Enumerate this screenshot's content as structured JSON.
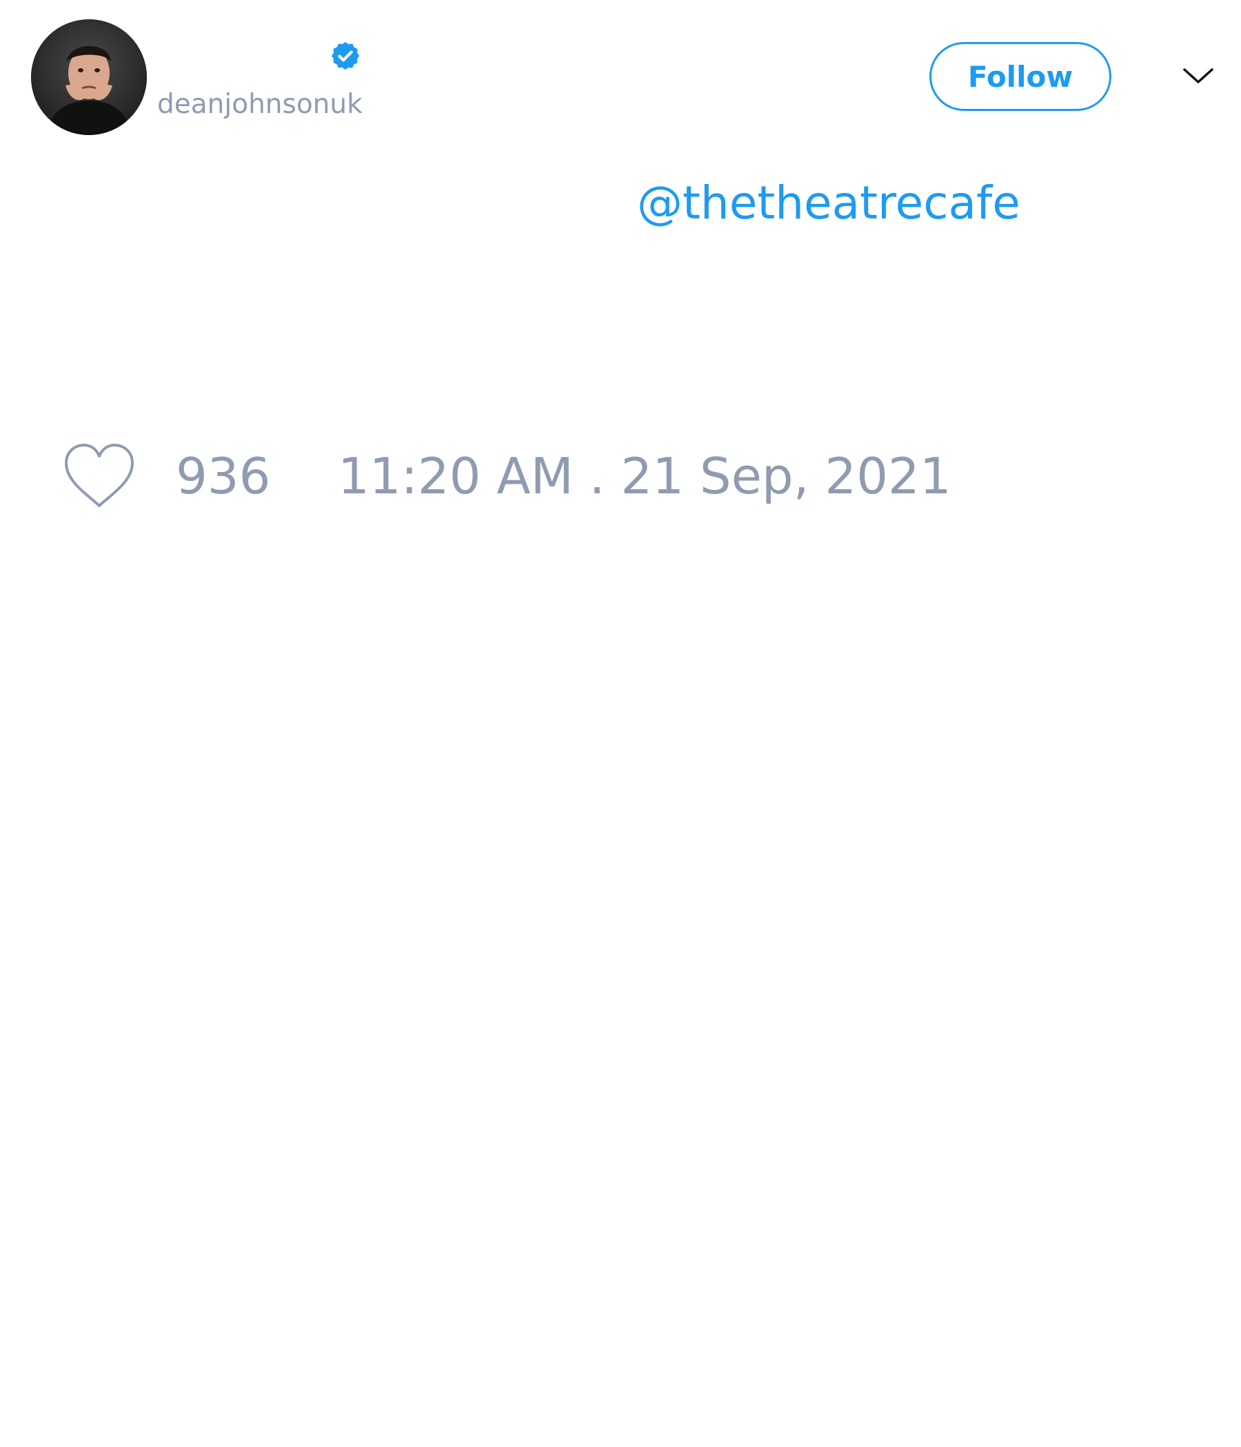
{
  "tweet": {
    "author": {
      "username": "deanjohnsonuk",
      "verified": true,
      "avatar_icon": "profile-photo"
    },
    "follow_label": "Follow",
    "menu_icon": "chevron-down-icon",
    "mention": "@thetheatrecafe",
    "likes": "936",
    "timestamp": "11:20 AM . 21 Sep, 2021"
  },
  "colors": {
    "accent": "#1d9bf0",
    "muted_text": "#8f9bb0",
    "background": "#ffffff"
  }
}
